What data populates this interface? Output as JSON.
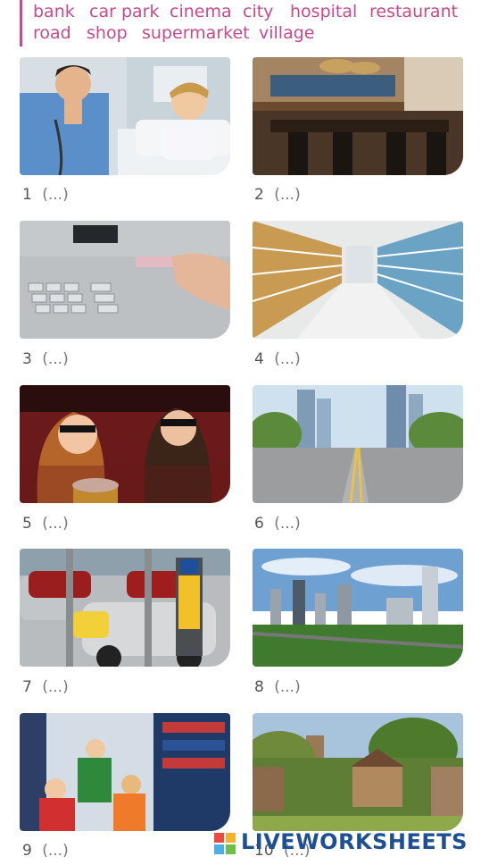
{
  "word_bank": {
    "row1": [
      "bank",
      "car park",
      "cinema",
      "city",
      "hospital",
      "restaurant"
    ],
    "row2": [
      "road",
      "shop",
      "supermarket",
      "village"
    ]
  },
  "items": [
    {
      "number": "1",
      "answer": "(...)",
      "scene": "hospital"
    },
    {
      "number": "2",
      "answer": "(...)",
      "scene": "restaurant"
    },
    {
      "number": "3",
      "answer": "(...)",
      "scene": "cash machine"
    },
    {
      "number": "4",
      "answer": "(...)",
      "scene": "supermarket aisle"
    },
    {
      "number": "5",
      "answer": "(...)",
      "scene": "3D cinema audience"
    },
    {
      "number": "6",
      "answer": "(...)",
      "scene": "empty road"
    },
    {
      "number": "7",
      "answer": "(...)",
      "scene": "car park"
    },
    {
      "number": "8",
      "answer": "(...)",
      "scene": "city skyline"
    },
    {
      "number": "9",
      "answer": "(...)",
      "scene": "clothes shop"
    },
    {
      "number": "10",
      "answer": "(...)",
      "scene": "village"
    }
  ],
  "footer": {
    "brand": "LIVEWORKSHEETS"
  },
  "colors": {
    "word_bank": "#c84a8c",
    "brand": "#1d4f95"
  }
}
